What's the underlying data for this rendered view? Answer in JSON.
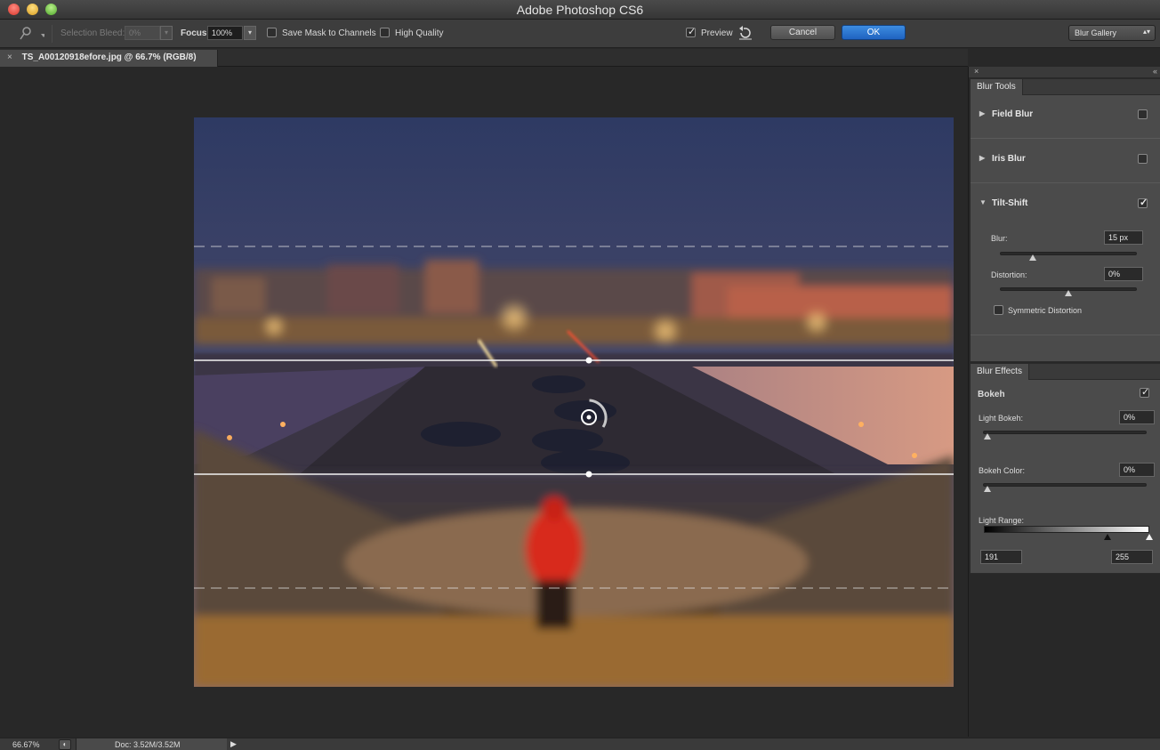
{
  "window": {
    "title": "Adobe Photoshop CS6"
  },
  "options_bar": {
    "tool_icon": "pin-icon",
    "selection_bleed_label": "Selection Bleed:",
    "selection_bleed_value": "0%",
    "focus_label": "Focus:",
    "focus_value": "100%",
    "save_mask_label": "Save Mask to Channels",
    "save_mask_checked": false,
    "high_quality_label": "High Quality",
    "high_quality_checked": false,
    "preview_label": "Preview",
    "preview_checked": true,
    "reset_icon": "undo-icon",
    "cancel_label": "Cancel",
    "ok_label": "OK",
    "workspace_value": "Blur Gallery"
  },
  "document_tab": {
    "title": "TS_A00120918efore.jpg @ 66.7% (RGB/8)",
    "close": "×"
  },
  "blur_tools": {
    "tab_label": "Blur Tools",
    "field_blur": {
      "label": "Field Blur",
      "checked": false,
      "expanded": false
    },
    "iris_blur": {
      "label": "Iris Blur",
      "checked": false,
      "expanded": false
    },
    "tilt_shift": {
      "label": "Tilt-Shift",
      "checked": true,
      "expanded": true,
      "blur_label": "Blur:",
      "blur_value": "15 px",
      "blur_level": 0.24,
      "distortion_label": "Distortion:",
      "distortion_value": "0%",
      "distortion_level": 0.5,
      "symmetric_label": "Symmetric Distortion",
      "symmetric_checked": false
    }
  },
  "blur_effects": {
    "tab_label": "Blur Effects",
    "bokeh_label": "Bokeh",
    "bokeh_checked": true,
    "light_bokeh_label": "Light Bokeh:",
    "light_bokeh_value": "0%",
    "bokeh_color_label": "Bokeh Color:",
    "bokeh_color_value": "0%",
    "light_range_label": "Light Range:",
    "light_range_low": "191",
    "light_range_high": "255"
  },
  "status_bar": {
    "zoom": "66.67%",
    "doc_info": "Doc: 3.52M/3.52M"
  },
  "colors": {
    "accent": "#2a74d4",
    "panel_bg": "#4b4b4b",
    "app_bg": "#282828"
  }
}
